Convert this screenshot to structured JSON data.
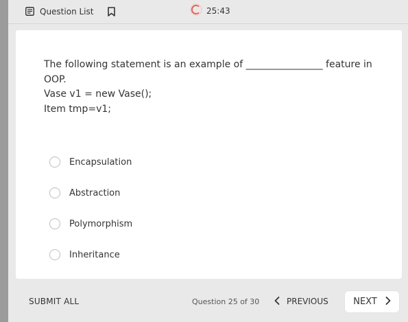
{
  "topbar": {
    "question_list_label": "Question List",
    "timer": "25:43"
  },
  "question": {
    "lines": [
      "The following statement is an example of ________________ feature in",
      "OOP.",
      "Vase v1 = new Vase();",
      "Item tmp=v1;"
    ]
  },
  "options": [
    {
      "label": "Encapsulation"
    },
    {
      "label": "Abstraction"
    },
    {
      "label": "Polymorphism"
    },
    {
      "label": "Inheritance"
    }
  ],
  "footer": {
    "submit_label": "SUBMIT ALL",
    "counter": "Question 25 of 30",
    "previous_label": "PREVIOUS",
    "next_label": "NEXT"
  },
  "colors": {
    "timer_accent": "#e05a4e",
    "page_bg": "#e9e9e9",
    "card_bg": "#ffffff"
  },
  "icons": [
    "list-icon",
    "bookmark-icon",
    "timer-icon",
    "chevron-left-icon",
    "chevron-right-icon"
  ]
}
